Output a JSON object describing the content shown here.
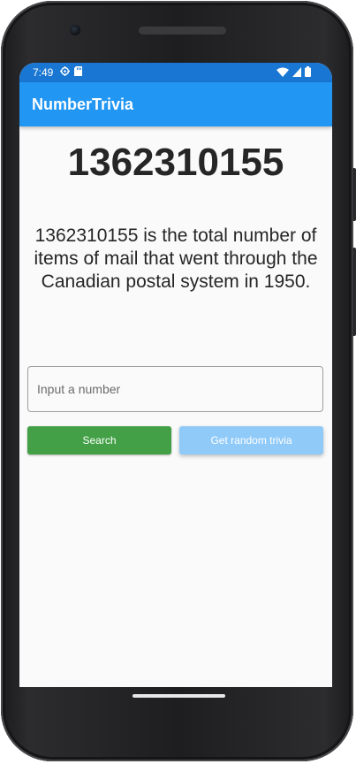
{
  "status_bar": {
    "time": "7:49",
    "left_icons": [
      "settings-icon",
      "sd-card-icon"
    ],
    "right_icons": [
      "wifi-icon",
      "signal-icon",
      "battery-icon"
    ],
    "color": "#1976d2"
  },
  "app_bar": {
    "title": "NumberTrivia",
    "color": "#2196f3"
  },
  "trivia": {
    "number": "1362310155",
    "text": "1362310155 is the total number of items of mail that went through the Canadian postal system in 1950."
  },
  "input": {
    "placeholder": "Input a number",
    "value": ""
  },
  "buttons": {
    "search_label": "Search",
    "random_label": "Get random trivia",
    "search_color": "#43a047",
    "random_color": "#90caf9"
  }
}
